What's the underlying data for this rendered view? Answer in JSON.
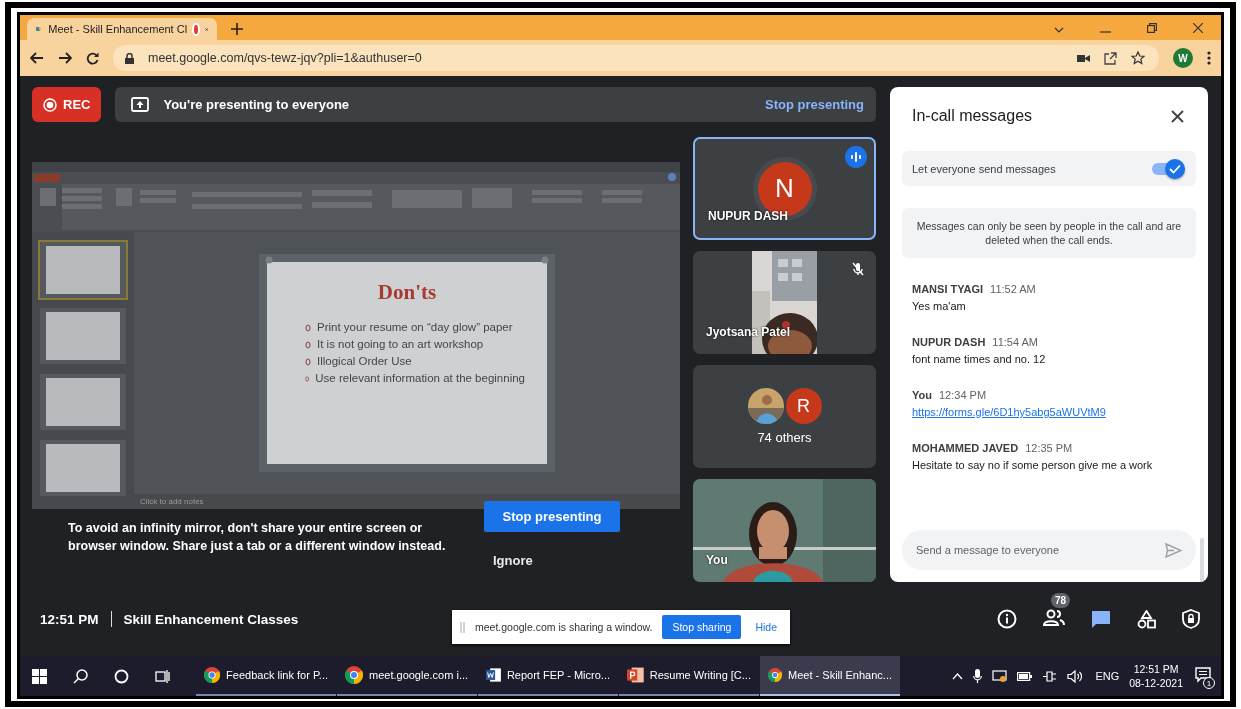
{
  "browser": {
    "tab": {
      "title": "Meet - Skill Enhancement Cl",
      "recording": true
    },
    "url": "meet.google.com/qvs-tewz-jqv?pli=1&authuser=0",
    "profile_initial": "W"
  },
  "recording": {
    "label": "REC"
  },
  "presenting_banner": {
    "text": "You're presenting to everyone",
    "action": "Stop presenting"
  },
  "shared_screen": {
    "slide_title": "Don'ts",
    "bullets": [
      "Print your resume on “day glow” paper",
      "It is not going to an art workshop",
      "Illogical Order Use",
      "Use relevant information at the beginning"
    ],
    "notes_placeholder": "Click to add notes"
  },
  "mirror_warning": {
    "text": "To avoid an infinity mirror, don't share your entire screen or browser window. Share just a tab or a different window instead.",
    "primary": "Stop presenting",
    "secondary": "Ignore"
  },
  "tiles": [
    {
      "kind": "avatar",
      "name": "NUPUR DASH",
      "initial": "N",
      "color": "#c5391a",
      "speaking": true,
      "muted": false
    },
    {
      "kind": "video",
      "name": "Jyotsana Patel",
      "speaking": false,
      "muted": true
    },
    {
      "kind": "others",
      "label": "74 others",
      "initial": "R",
      "color": "#c5391a",
      "speaking": false,
      "muted": false
    },
    {
      "kind": "self",
      "name": "You",
      "speaking": false,
      "muted": false
    }
  ],
  "chat": {
    "title": "In-call messages",
    "setting": {
      "label": "Let everyone send messages",
      "on": true
    },
    "notice": "Messages can only be seen by people in the call and are deleted when the call ends.",
    "messages": [
      {
        "sender": "MANSI TYAGI",
        "time": "11:52 AM",
        "text": "Yes ma'am",
        "kind": "text"
      },
      {
        "sender": "NUPUR DASH",
        "time": "11:54 AM",
        "text": "font name times and no. 12",
        "kind": "text"
      },
      {
        "sender": "You",
        "time": "12:34 PM",
        "text": "https://forms.gle/6D1hy5abg5aWUVtM9",
        "kind": "link"
      },
      {
        "sender": "MOHAMMED JAVED",
        "time": "12:35 PM",
        "text": "Hesitate to say no if some person give me a  work",
        "kind": "text"
      }
    ],
    "input_placeholder": "Send a message to everyone"
  },
  "meeting_info": {
    "time": "12:51 PM",
    "title": "Skill Enhancement Classes",
    "participants_count": "78"
  },
  "share_bar": {
    "text": "meet.google.com is sharing a window.",
    "stop": "Stop sharing",
    "hide": "Hide"
  },
  "taskbar": {
    "items": [
      {
        "label": "Feedback link for P...",
        "kind": "chrome",
        "selected": false
      },
      {
        "label": "meet.google.com i...",
        "kind": "chrome",
        "selected": false
      },
      {
        "label": "Report FEP - Micro...",
        "kind": "word",
        "selected": false
      },
      {
        "label": "Resume Writing [C...",
        "kind": "powerpoint",
        "selected": false
      },
      {
        "label": "Meet - Skill Enhanc...",
        "kind": "chrome",
        "selected": true
      }
    ],
    "language": "ENG",
    "time": "12:51 PM",
    "date": "08-12-2021",
    "notifications": "1"
  }
}
